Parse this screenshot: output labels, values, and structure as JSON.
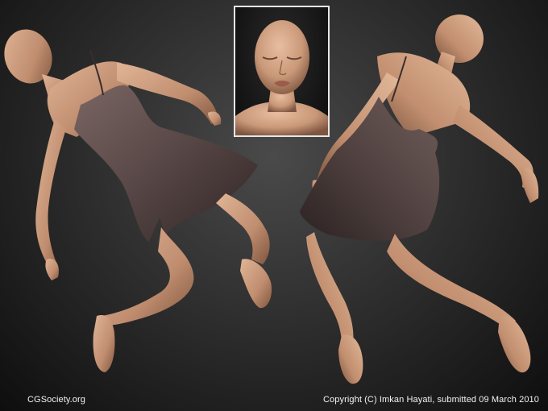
{
  "render": {
    "title": "",
    "credit_left": "CGSociety.org",
    "credit_right": "Copyright (C) Imkan Hayati, submitted 09 March 2010"
  },
  "colors": {
    "skin": "#c89a7c",
    "skin_shadow": "#8a5f47",
    "dress": "#5a4a47",
    "dress_shadow": "#3a2e2c",
    "background": "#2a2a2a",
    "inset_border": "#e6e6e6",
    "caption": "#f2f2f2"
  }
}
